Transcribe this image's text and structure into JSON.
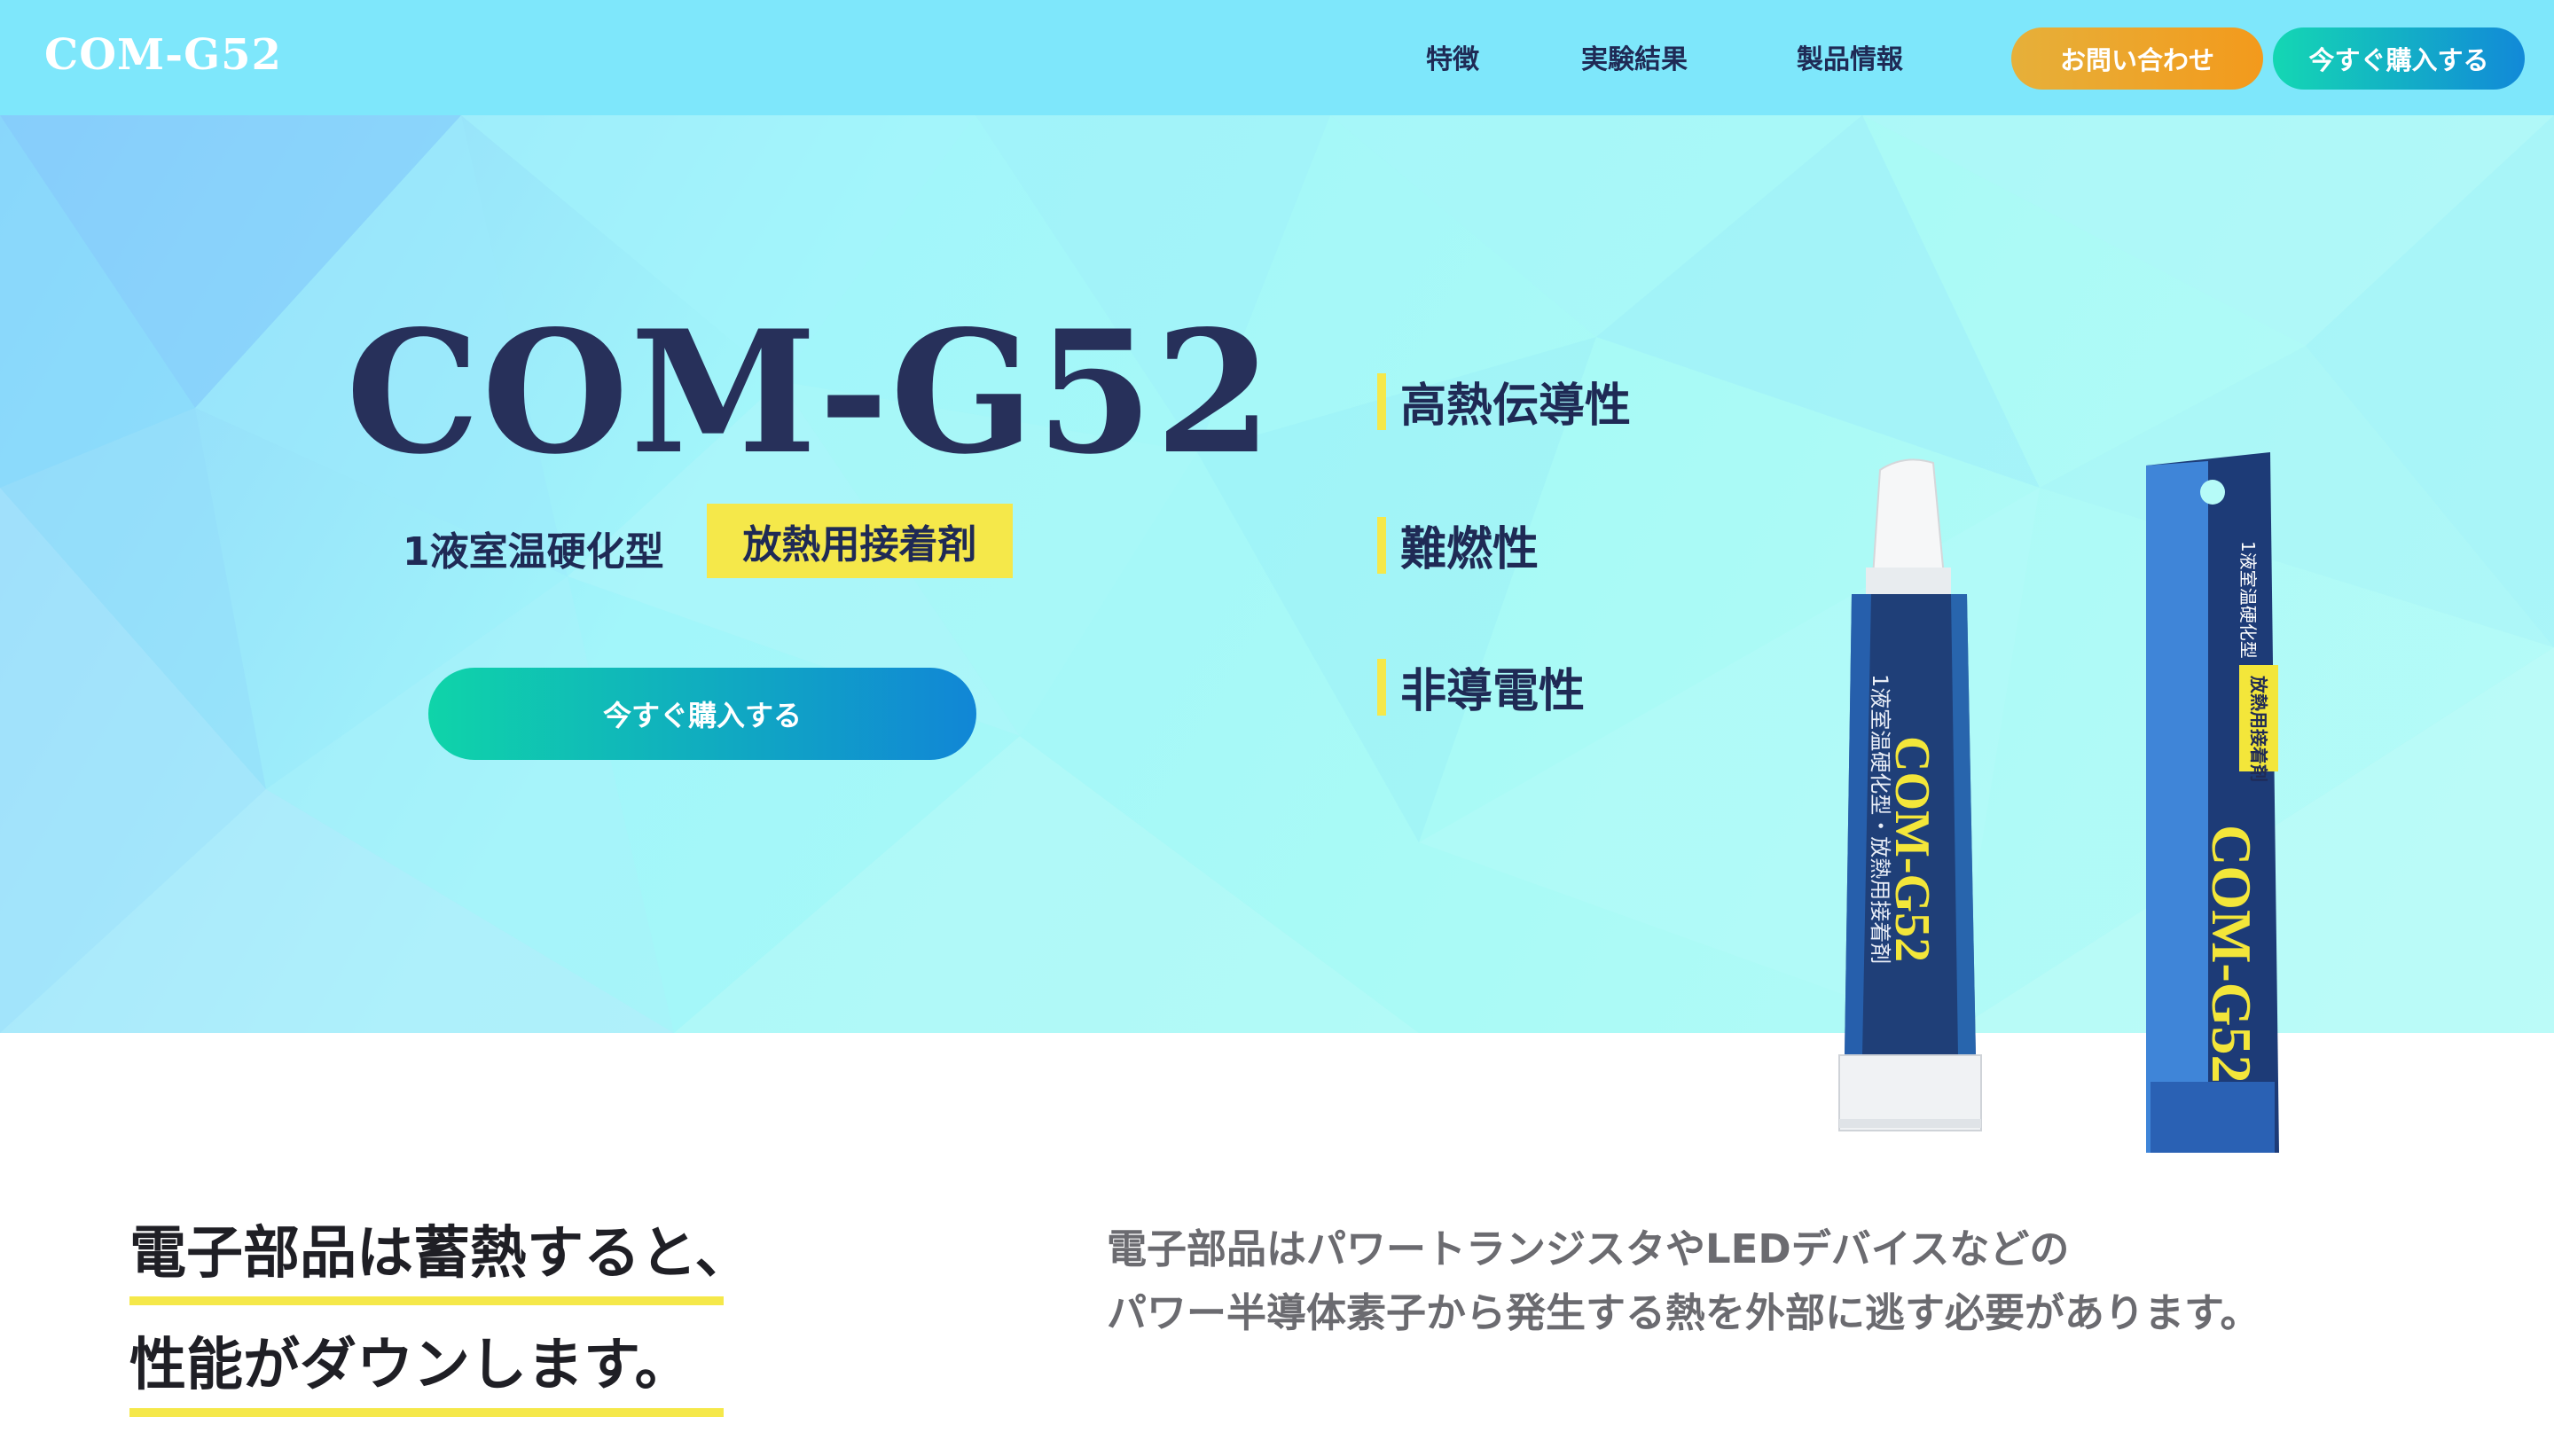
{
  "header": {
    "logo": "COM-G52",
    "nav": [
      "特徴",
      "実験結果",
      "製品情報"
    ],
    "contact_button": "お問い合わせ",
    "buy_button": "今すぐ購入する"
  },
  "hero": {
    "title": "COM-G52",
    "subtitle": "1液室温硬化型",
    "badge": "放熱用接着剤",
    "cta": "今すぐ購入する",
    "features": [
      "高熱伝導性",
      "難燃性",
      "非導電性"
    ]
  },
  "product": {
    "tube_text_vertical": "1液室温硬化型・放熱用接着剤",
    "tube_brand": "COM-G52",
    "box_brand": "COM-G52",
    "box_top_text": "1液室温硬化型",
    "box_badge": "放熱用接着剤"
  },
  "intro": {
    "heading_line1": "電子部品は蓄熱すると、",
    "heading_line2": "性能がダウンします。",
    "body_line1": "電子部品はパワートランジスタやLEDデバイスなどの",
    "body_line2": "パワー半導体素子から発生する熱を外部に逃す必要があります。"
  },
  "colors": {
    "header_bg": "#7ee7fb",
    "accent_yellow": "#f5e84a",
    "navy": "#1f2a55",
    "cta_gradient_start": "#0fd4a9",
    "cta_gradient_end": "#1186d6",
    "contact_gradient": "#e6b03a"
  }
}
